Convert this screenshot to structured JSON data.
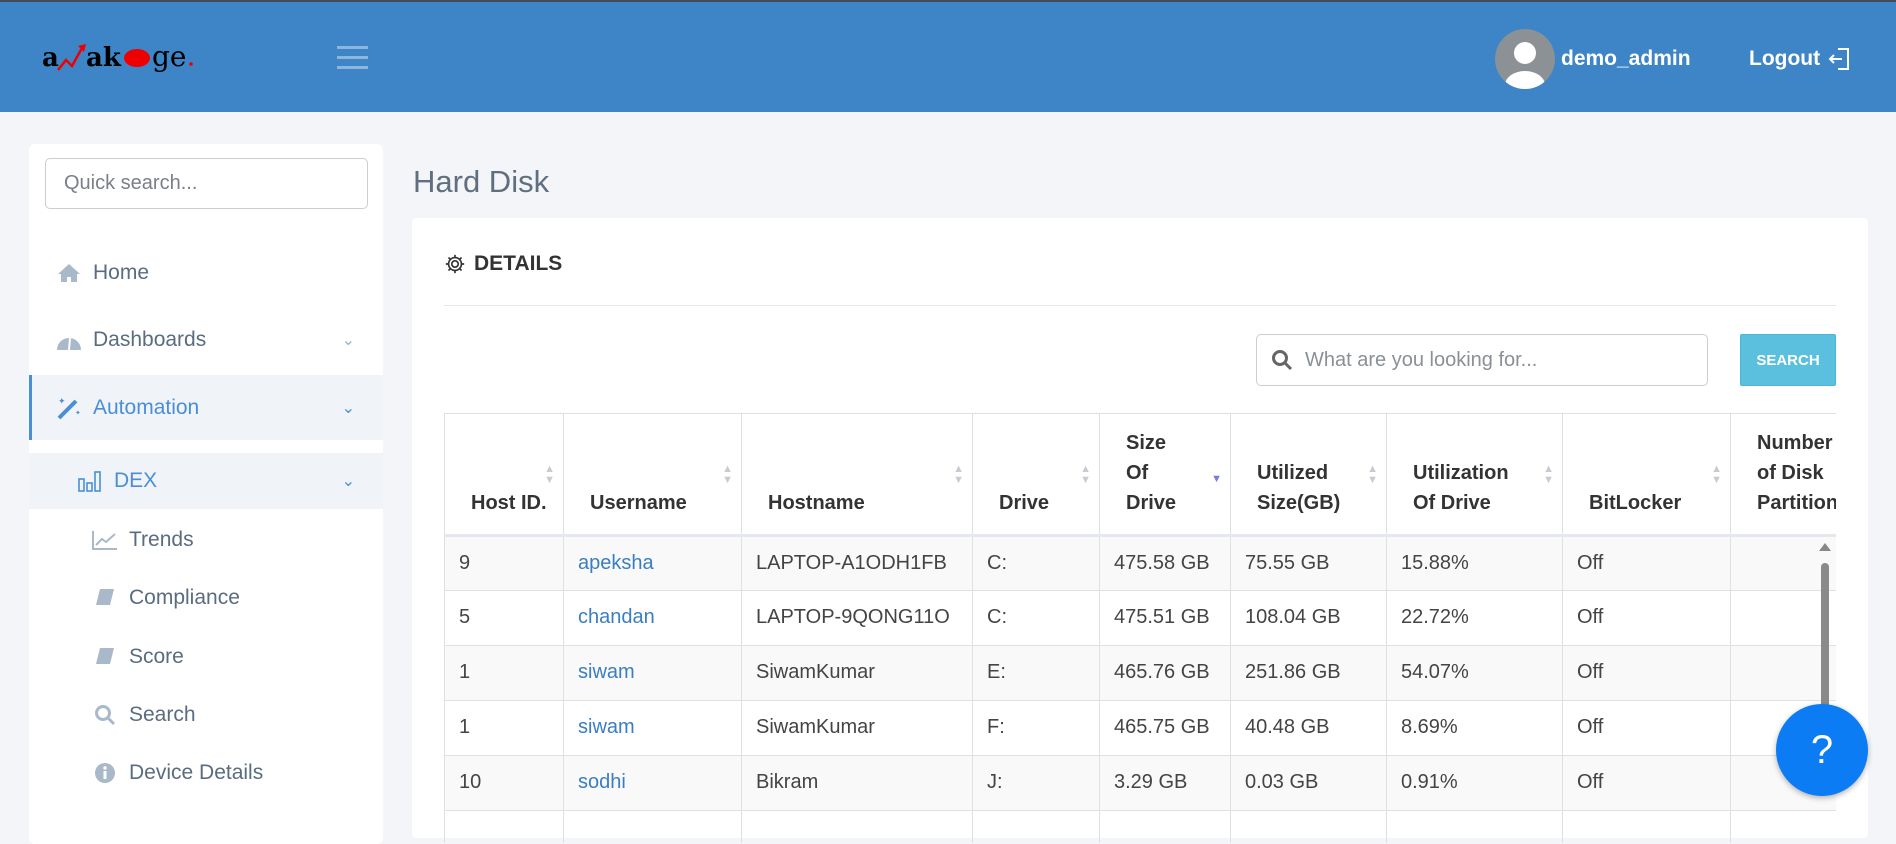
{
  "header": {
    "logo_text": "anakage",
    "user": "demo_admin",
    "logout": "Logout"
  },
  "sidebar": {
    "search_placeholder": "Quick search...",
    "items": [
      {
        "label": "Home"
      },
      {
        "label": "Dashboards"
      },
      {
        "label": "Automation"
      },
      {
        "label": "DEX"
      },
      {
        "label": "Trends"
      },
      {
        "label": "Compliance"
      },
      {
        "label": "Score"
      },
      {
        "label": "Search"
      },
      {
        "label": "Device Details"
      }
    ]
  },
  "page": {
    "title": "Hard Disk",
    "section": "DETAILS",
    "search_placeholder": "What are you looking for...",
    "search_button": "SEARCH"
  },
  "table": {
    "columns": [
      "Host ID.",
      "Username",
      "Hostname",
      "Drive",
      "Size Of Drive",
      "Utilized Size(GB)",
      "Utilization Of Drive",
      "BitLocker",
      "Number of Disk Partitions"
    ],
    "rows": [
      [
        "9",
        "apeksha",
        "LAPTOP-A1ODH1FB",
        "C:",
        "475.58 GB",
        "75.55 GB",
        "15.88%",
        "Off",
        ""
      ],
      [
        "5",
        "chandan",
        "LAPTOP-9QONG11O",
        "C:",
        "475.51 GB",
        "108.04 GB",
        "22.72%",
        "Off",
        ""
      ],
      [
        "1",
        "siwam",
        "SiwamKumar",
        "E:",
        "465.76 GB",
        "251.86 GB",
        "54.07%",
        "Off",
        ""
      ],
      [
        "1",
        "siwam",
        "SiwamKumar",
        "F:",
        "465.75 GB",
        "40.48 GB",
        "8.69%",
        "Off",
        ""
      ],
      [
        "10",
        "sodhi",
        "Bikram",
        "J:",
        "3.29 GB",
        "0.03 GB",
        "0.91%",
        "Off",
        ""
      ],
      [
        "",
        "",
        "",
        "",
        "",
        "",
        "",
        "",
        ""
      ]
    ]
  },
  "help_label": "?"
}
